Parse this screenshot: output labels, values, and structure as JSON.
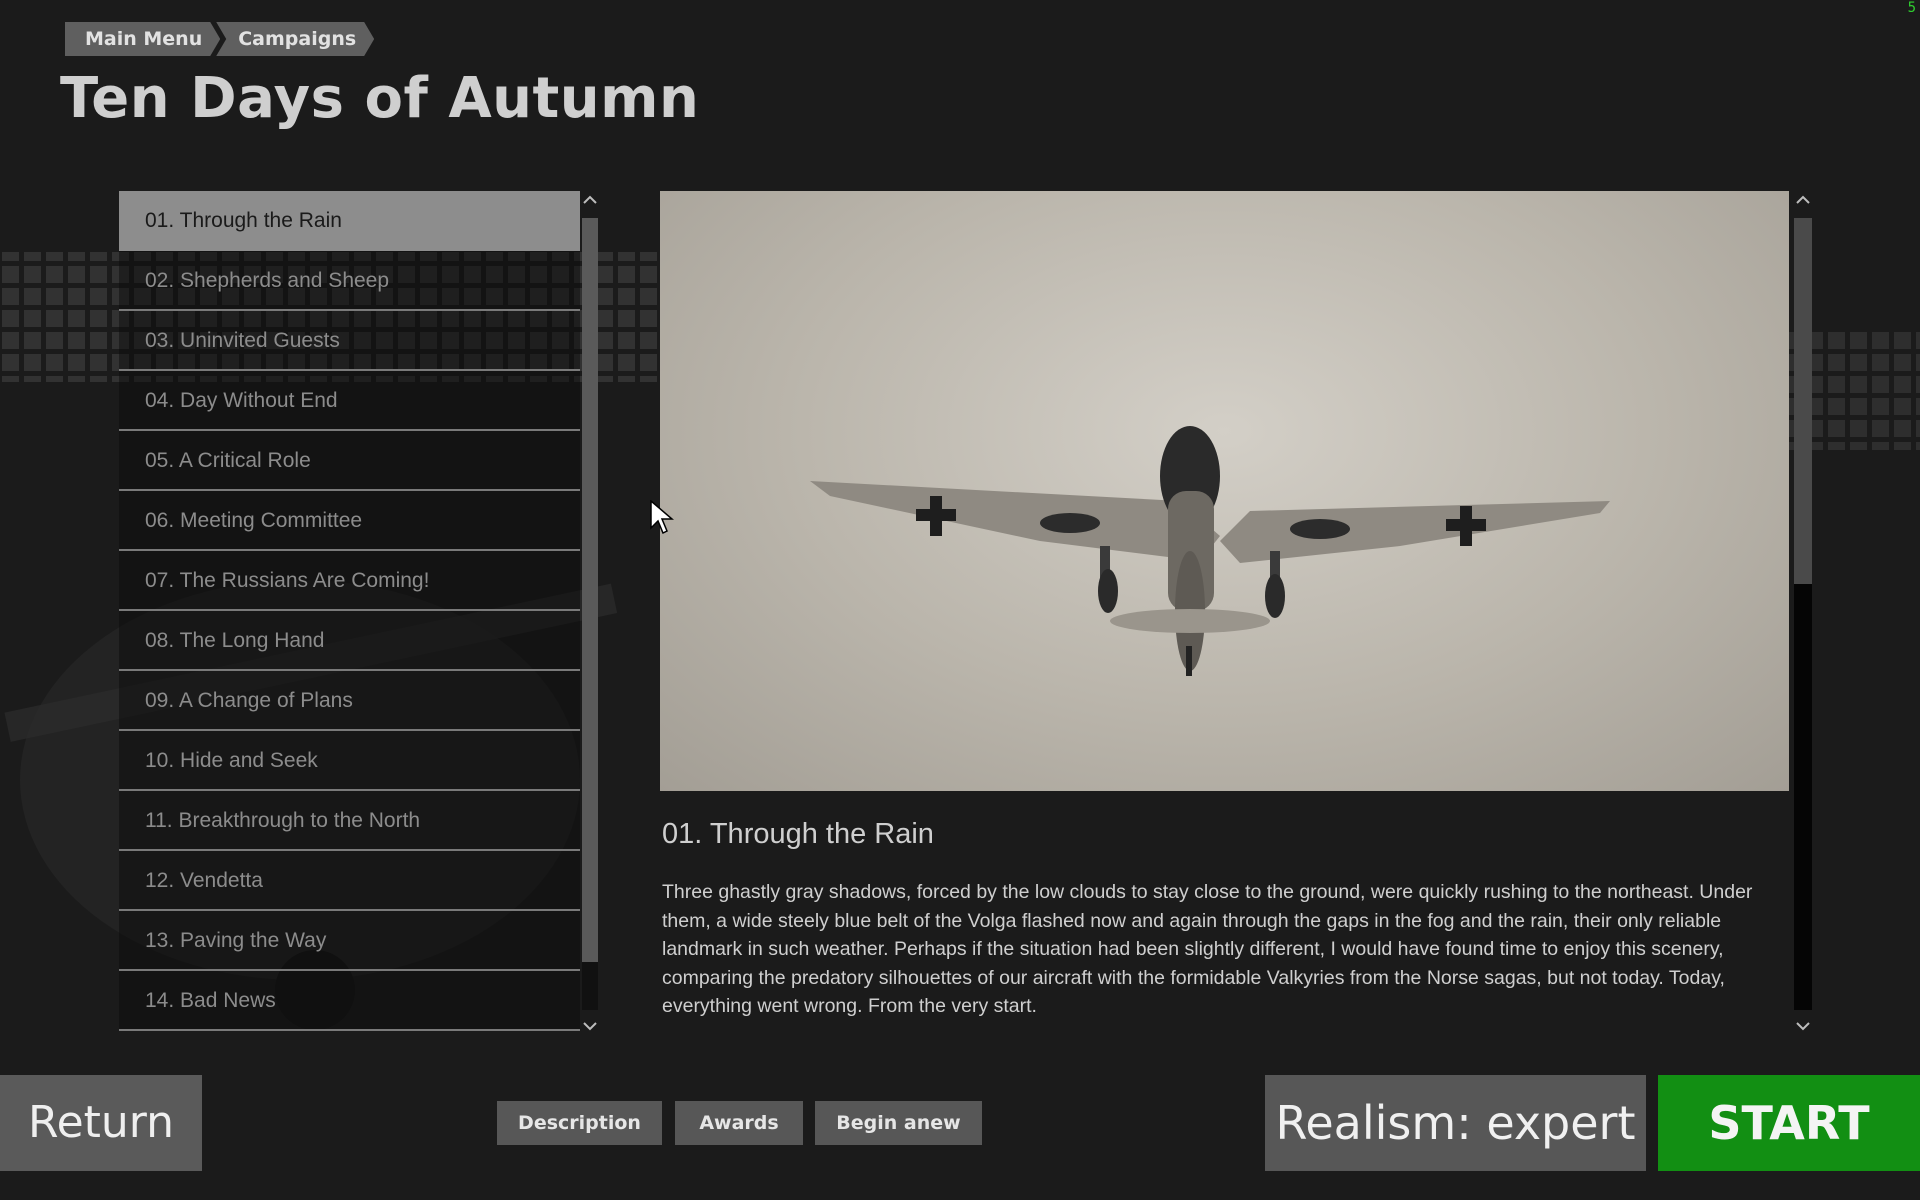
{
  "fps_counter": "5",
  "breadcrumb": {
    "items": [
      "Main Menu",
      "Campaigns"
    ]
  },
  "campaign": {
    "title": "Ten Days of Autumn"
  },
  "missions": {
    "selected_index": 0,
    "items": [
      "01. Through the Rain",
      "02. Shepherds and Sheep",
      "03. Uninvited Guests",
      "04. Day Without End",
      "05. A Critical Role",
      "06. Meeting Committee",
      "07. The Russians Are Coming!",
      "08. The Long Hand",
      "09. A Change of Plans",
      "10. Hide and Seek",
      "11. Breakthrough to the North",
      "12. Vendetta",
      "13. Paving the Way",
      "14. Bad News"
    ]
  },
  "description": {
    "title": "01. Through the Rain",
    "text": "Three ghastly gray shadows, forced by the low clouds to stay close to the ground, were quickly rushing to the northeast. Under them, a wide steely blue belt of the Volga flashed now and again through the gaps in the fog and the rain, their only reliable landmark in such weather. Perhaps if the situation had been slightly different, I would have found time to enjoy this scenery, comparing the predatory silhouettes of our aircraft with the formidable Valkyries from the Norse sagas, but not today. Today, everything went wrong. From the very start."
  },
  "icons": {
    "scroll_up": "chevron-up-icon",
    "scroll_down": "chevron-down-icon",
    "cursor": "mouse-pointer-icon"
  },
  "bottom_bar": {
    "return_label": "Return",
    "tabs": [
      "Description",
      "Awards",
      "Begin anew"
    ],
    "realism_label": "Realism: expert",
    "start_label": "START"
  },
  "colors": {
    "background": "#1b1b1b",
    "button_gray": "#575757",
    "selected_item": "#8d8d8d",
    "start_green": "#128f13",
    "fps_green": "#2fcf2f"
  }
}
